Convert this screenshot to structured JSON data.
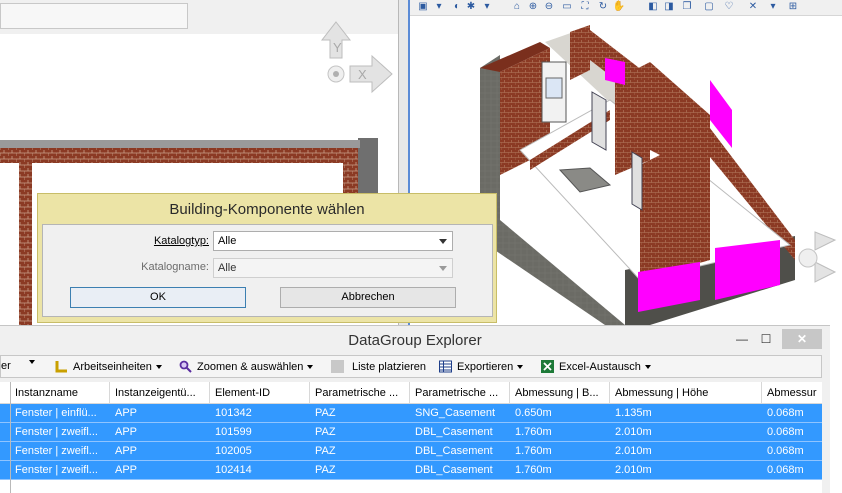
{
  "dialog": {
    "title": "Building-Komponente wählen",
    "katalogtyp_label": "Katalogtyp:",
    "katalogtyp_value": "Alle",
    "katalogname_label": "Katalogname:",
    "katalogname_value": "Alle",
    "ok_label": "OK",
    "cancel_label": "Abbrechen"
  },
  "view_cube": {
    "y_label": "Y",
    "x_label": "X"
  },
  "explorer": {
    "title": "DataGroup Explorer",
    "min_glyph": "—",
    "max_glyph": "☐",
    "close_glyph": "✕",
    "toolbar": {
      "truncated_label": "er",
      "arbeitseinheiten": "Arbeitseinheiten",
      "zoomen": "Zoomen & auswählen",
      "liste": "Liste platzieren",
      "exportieren": "Exportieren",
      "excel": "Excel-Austausch"
    },
    "columns": [
      "Instanzname",
      "Instanzeigentü...",
      "Element-ID",
      "Parametrische ...",
      "Parametrische ...",
      "Abmessung | B...",
      "Abmessung | Höhe",
      "Abmessur"
    ],
    "rows": [
      [
        "Fenster | einflü...",
        "APP",
        "101342",
        "PAZ",
        "SNG_Casement",
        "0.650m",
        "1.135m",
        "0.068m"
      ],
      [
        "Fenster | zweifl...",
        "APP",
        "101599",
        "PAZ",
        "DBL_Casement",
        "1.760m",
        "2.010m",
        "0.068m"
      ],
      [
        "Fenster | zweifl...",
        "APP",
        "102005",
        "PAZ",
        "DBL_Casement",
        "1.760m",
        "2.010m",
        "0.068m"
      ],
      [
        "Fenster | zweifl...",
        "APP",
        "102414",
        "PAZ",
        "DBL_Casement",
        "1.760m",
        "2.010m",
        "0.068m"
      ]
    ]
  },
  "colors": {
    "dialog_bg": "#ece4a6",
    "selection": "#3399ff",
    "brick": "#8b3a24",
    "magenta": "#ff00ff"
  },
  "icons": [
    "view-cube-icon",
    "units-icon",
    "zoom-icon",
    "place-list-icon",
    "export-icon",
    "excel-icon",
    "minimize-icon",
    "maximize-icon",
    "close-icon"
  ]
}
